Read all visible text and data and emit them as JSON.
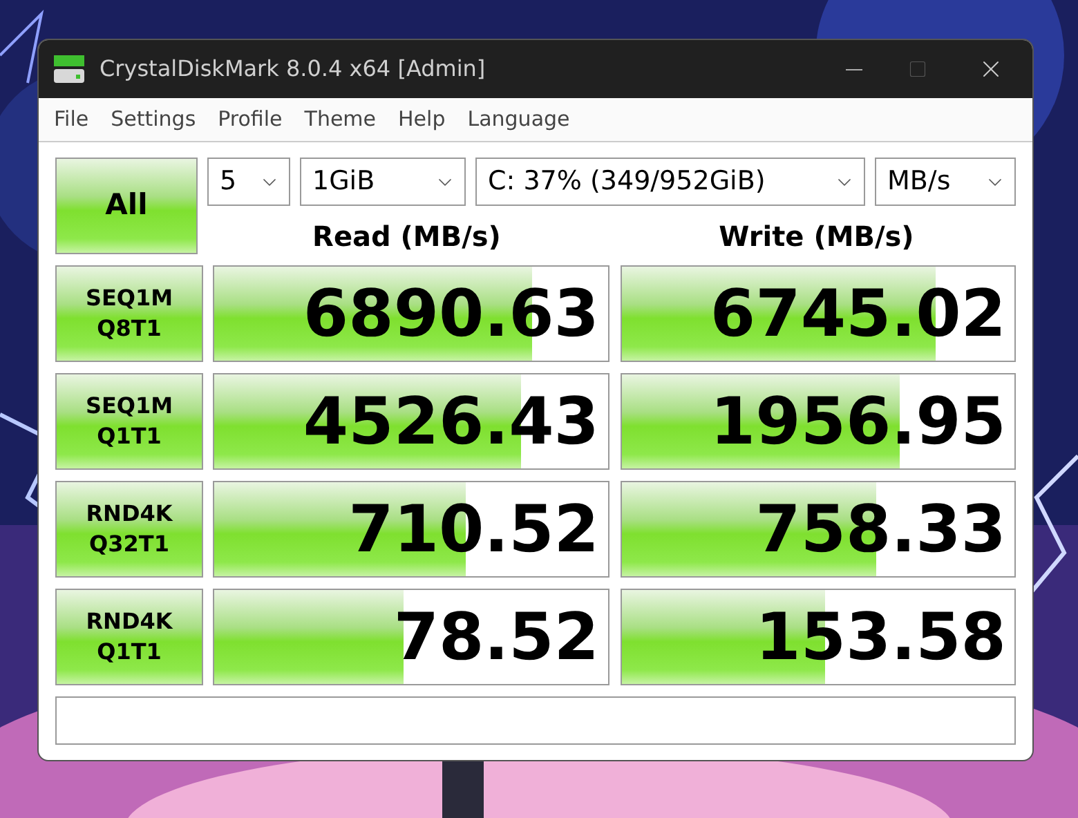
{
  "window": {
    "title": "CrystalDiskMark 8.0.4 x64 [Admin]"
  },
  "menu": [
    "File",
    "Settings",
    "Profile",
    "Theme",
    "Help",
    "Language"
  ],
  "all_button": "All",
  "selectors": [
    {
      "value": "5"
    },
    {
      "value": "1GiB"
    },
    {
      "value": "C: 37% (349/952GiB)"
    },
    {
      "value": "MB/s"
    }
  ],
  "headers": [
    "Read (MB/s)",
    "Write (MB/s)"
  ],
  "tests": [
    {
      "name": "SEQ1M",
      "params": "Q8T1",
      "read": {
        "value": "6890.63",
        "level": 0.81
      },
      "write": {
        "value": "6745.02",
        "level": 0.8
      }
    },
    {
      "name": "SEQ1M",
      "params": "Q1T1",
      "read": {
        "value": "4526.43",
        "level": 0.78
      },
      "write": {
        "value": "1956.95",
        "level": 0.71
      }
    },
    {
      "name": "RND4K",
      "params": "Q32T1",
      "read": {
        "value": "710.52",
        "level": 0.64
      },
      "write": {
        "value": "758.33",
        "level": 0.65
      }
    },
    {
      "name": "RND4K",
      "params": "Q1T1",
      "read": {
        "value": "78.52",
        "level": 0.48
      },
      "write": {
        "value": "153.58",
        "level": 0.52
      }
    }
  ]
}
